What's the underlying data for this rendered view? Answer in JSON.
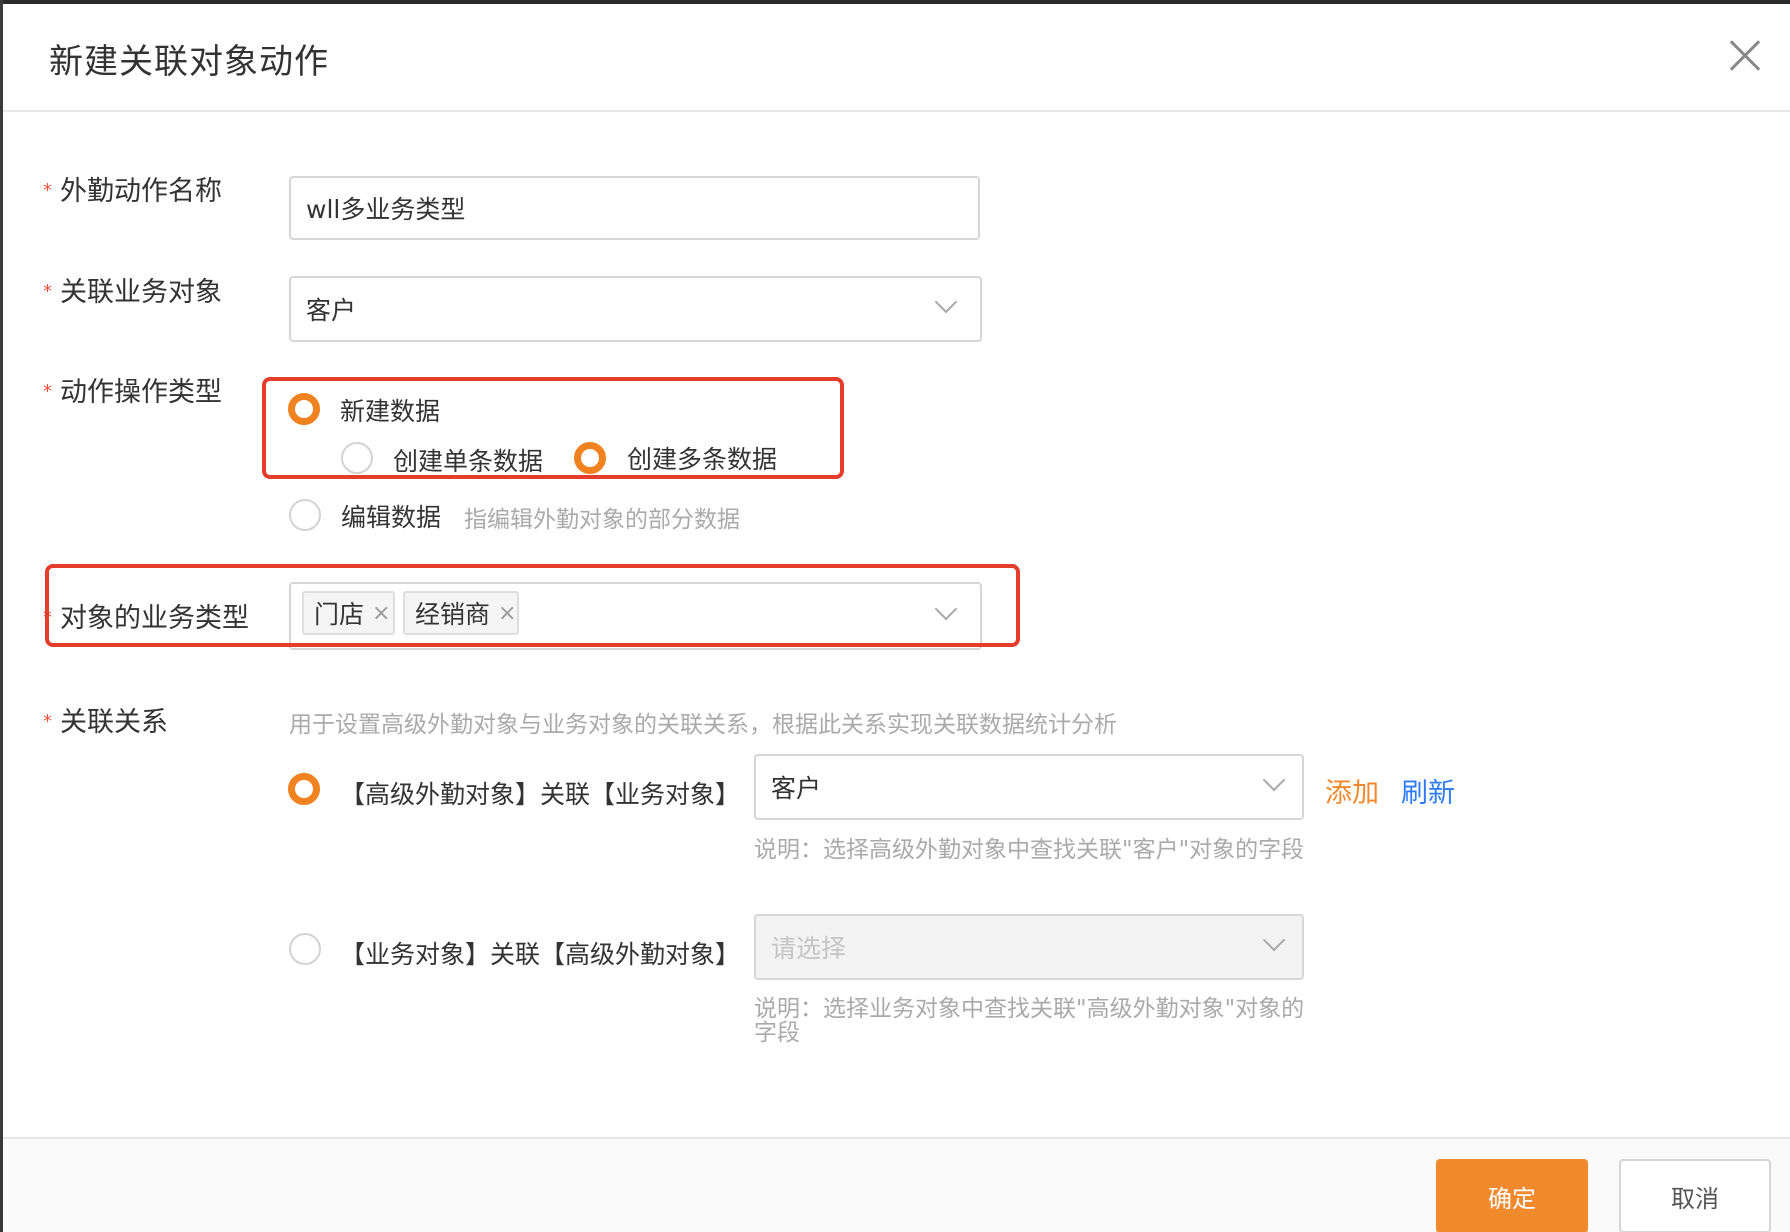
{
  "dialog": {
    "title": "新建关联对象动作",
    "close_icon": "close-icon"
  },
  "form": {
    "required_mark": "*",
    "action_name": {
      "label": "外勤动作名称",
      "value": "wll多业务类型"
    },
    "related_object": {
      "label": "关联业务对象",
      "value": "客户"
    },
    "operation_type": {
      "label": "动作操作类型",
      "option_new": "新建数据",
      "option_single": "创建单条数据",
      "option_multi": "创建多条数据",
      "option_edit": "编辑数据",
      "option_edit_hint": "指编辑外勤对象的部分数据"
    },
    "business_type": {
      "label": "对象的业务类型",
      "tags": [
        "门店",
        "经销商"
      ],
      "remove_glyph": "×"
    },
    "relation": {
      "label": "关联关系",
      "hint": "用于设置高级外勤对象与业务对象的关联关系，根据此关系实现关联数据统计分析",
      "option_a_label": "【高级外勤对象】关联【业务对象】",
      "option_a_value": "客户",
      "option_a_desc": "说明：选择高级外勤对象中查找关联\"客户\"对象的字段",
      "add_link": "添加",
      "refresh_link": "刷新",
      "option_b_label": "【业务对象】关联【高级外勤对象】",
      "option_b_placeholder": "请选择",
      "option_b_desc": "说明：选择业务对象中查找关联\"高级外勤对象\"对象的字段"
    }
  },
  "footer": {
    "confirm": "确定",
    "cancel": "取消"
  },
  "colors": {
    "accent": "#f08a2c",
    "link_blue": "#2f7bf5",
    "highlight_red": "#e53d2b"
  }
}
